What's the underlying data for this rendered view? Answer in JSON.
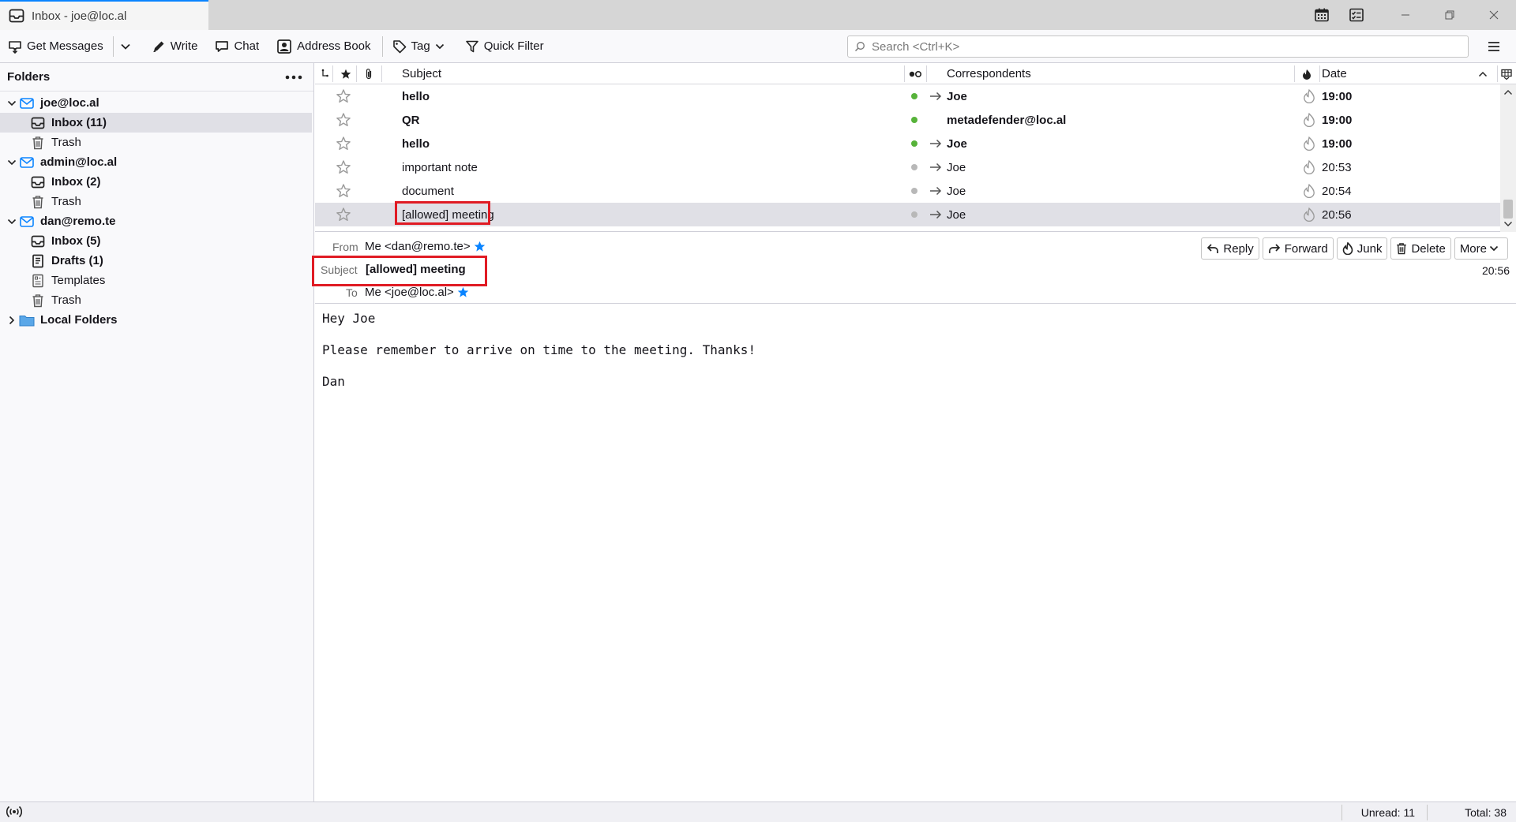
{
  "window": {
    "tab_title": "Inbox - joe@loc.al"
  },
  "toolbar": {
    "get_messages": "Get Messages",
    "write": "Write",
    "chat": "Chat",
    "address_book": "Address Book",
    "tag": "Tag",
    "quick_filter": "Quick Filter",
    "search_placeholder": "Search <Ctrl+K>"
  },
  "folders": {
    "header": "Folders",
    "joe_account": "joe@loc.al",
    "joe_inbox": "Inbox (11)",
    "joe_trash": "Trash",
    "admin_account": "admin@loc.al",
    "admin_inbox": "Inbox (2)",
    "admin_trash": "Trash",
    "dan_account": "dan@remo.te",
    "dan_inbox": "Inbox (5)",
    "dan_drafts": "Drafts (1)",
    "dan_templates": "Templates",
    "dan_trash": "Trash",
    "local_folders": "Local Folders"
  },
  "thread_columns": {
    "subject": "Subject",
    "correspondents": "Correspondents",
    "date": "Date"
  },
  "messages": [
    {
      "subject": "hello",
      "correspondent": "Joe",
      "date": "19:00",
      "unread": true,
      "arrow": true
    },
    {
      "subject": "QR",
      "correspondent": "metadefender@loc.al",
      "date": "19:00",
      "unread": true,
      "arrow": false
    },
    {
      "subject": "hello",
      "correspondent": "Joe",
      "date": "19:00",
      "unread": true,
      "arrow": true
    },
    {
      "subject": "important note",
      "correspondent": "Joe",
      "date": "20:53",
      "unread": false,
      "arrow": true
    },
    {
      "subject": "document",
      "correspondent": "Joe",
      "date": "20:54",
      "unread": false,
      "arrow": true
    },
    {
      "subject": "[allowed] meeting",
      "correspondent": "Joe",
      "date": "20:56",
      "unread": false,
      "arrow": true,
      "selected": true
    }
  ],
  "message_header": {
    "from_label": "From",
    "from_value": "Me <dan@remo.te>",
    "subject_label": "Subject",
    "subject_value": "[allowed] meeting",
    "to_label": "To",
    "to_value": "Me <joe@loc.al>",
    "time": "20:56",
    "reply": "Reply",
    "forward": "Forward",
    "junk": "Junk",
    "delete": "Delete",
    "more": "More"
  },
  "message_body": {
    "line1": "Hey Joe",
    "line2": "Please remember to arrive on time to the meeting. Thanks!",
    "line3": "Dan"
  },
  "statusbar": {
    "unread": "Unread: 11",
    "total": "Total: 38"
  },
  "colors": {
    "accent": "#0a84ff",
    "highlight": "#e01b24",
    "unread_dot": "#57b33a",
    "read_dot": "#b8b8b8",
    "star_contact": "#0a84ff"
  }
}
